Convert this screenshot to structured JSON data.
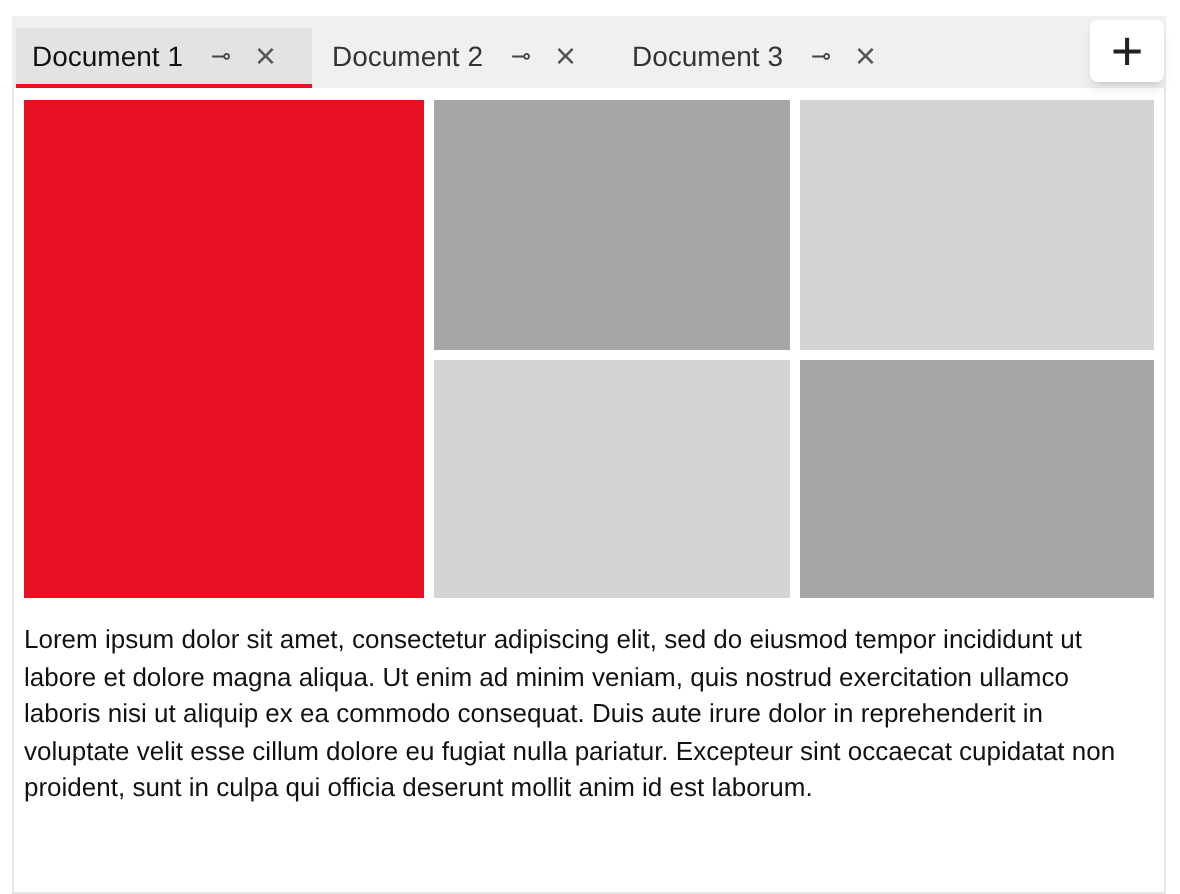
{
  "tabs": [
    {
      "label": "Document 1",
      "selected": true,
      "pin": "⊸",
      "close": "×"
    },
    {
      "label": "Document 2",
      "selected": false,
      "pin": "⊸",
      "close": "×"
    },
    {
      "label": "Document 3",
      "selected": false,
      "pin": "⊸",
      "close": "×"
    }
  ],
  "add_button": "+",
  "tiles": [
    {
      "color": "#e81123"
    },
    {
      "color": "#a6a6a6"
    },
    {
      "color": "#d4d4d4"
    },
    {
      "color": "#d4d4d4"
    },
    {
      "color": "#a6a6a6"
    }
  ],
  "text": "Lorem ipsum dolor sit amet, consectetur adipiscing elit, sed do eiusmod tempor incididunt ut labore et dolore magna aliqua. Ut enim ad minim veniam, quis nostrud exercitation ullamco laboris nisi ut aliquip ex ea commodo consequat. Duis aute irure dolor in reprehenderit in voluptate velit esse cillum dolore eu fugiat nulla pariatur. Excepteur sint occaecat cupidatat non proident, sunt in culpa qui officia deserunt mollit anim id est laborum."
}
